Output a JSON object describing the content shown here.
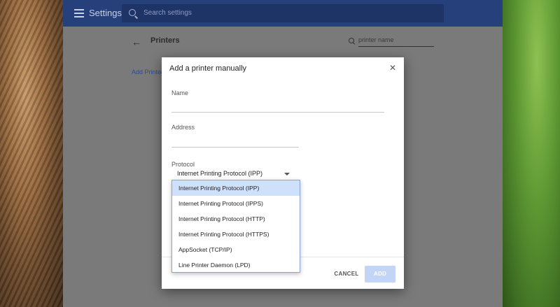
{
  "topbar": {
    "title": "Settings",
    "search_placeholder": "Search settings"
  },
  "printers_page": {
    "title": "Printers",
    "filter_value": "printer name",
    "add_printer_link": "Add Printer"
  },
  "dialog": {
    "title": "Add a printer manually",
    "name_label": "Name",
    "address_label": "Address",
    "protocol_label": "Protocol",
    "protocol_selected": "Internet Printing Protocol (IPP)",
    "cancel_label": "CANCEL",
    "add_label": "ADD"
  },
  "dropdown": {
    "selected_index": 0,
    "options": [
      "Internet Printing Protocol (IPP)",
      "Internet Printing Protocol (IPPS)",
      "Internet Printing Protocol (HTTP)",
      "Internet Printing Protocol (HTTPS)",
      "AppSocket (TCP/IP)",
      "Line Printer Daemon (LPD)"
    ]
  },
  "colors": {
    "topbar": "#26407c",
    "selected_option": "#cfe0fb",
    "add_button_disabled": "#c3d5f6"
  }
}
